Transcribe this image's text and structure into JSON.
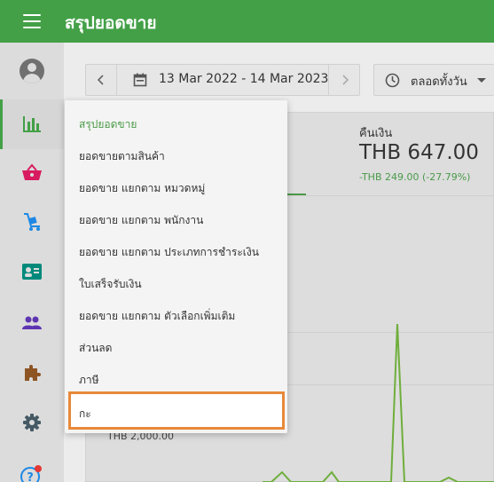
{
  "app": {
    "title": "สรุปยอดขาย"
  },
  "toolbar": {
    "date_range": "13 Mar 2022 - 14 Mar 2023",
    "time_filter": "ตลอดทั้งวัน"
  },
  "summary": {
    "refund_label": "คืนเงิน",
    "refund_value": "THB 647.00",
    "refund_change": "-THB 249.00 (-27.79%)"
  },
  "chart": {
    "y_tick": "THB 2,000.00"
  },
  "menu": {
    "items": [
      "สรุปยอดขาย",
      "ยอดขายตามสินค้า",
      "ยอดขาย แยกตาม หมวดหมู่",
      "ยอดขาย แยกตาม พนักงาน",
      "ยอดขาย แยกตาม ประเภทการชำระเงิน",
      "ใบเสร็จรับเงิน",
      "ยอดขาย แยกตาม ตัวเลือกเพิ่มเติม",
      "ส่วนลด",
      "ภาษี",
      "กะ"
    ]
  },
  "colors": {
    "primary": "#43a047",
    "highlight": "#e8893a"
  },
  "sidebar_icons": [
    "account-icon",
    "reports-icon",
    "basket-icon",
    "inventory-icon",
    "employee-card-icon",
    "customers-icon",
    "integrations-icon",
    "settings-icon",
    "help-icon"
  ]
}
